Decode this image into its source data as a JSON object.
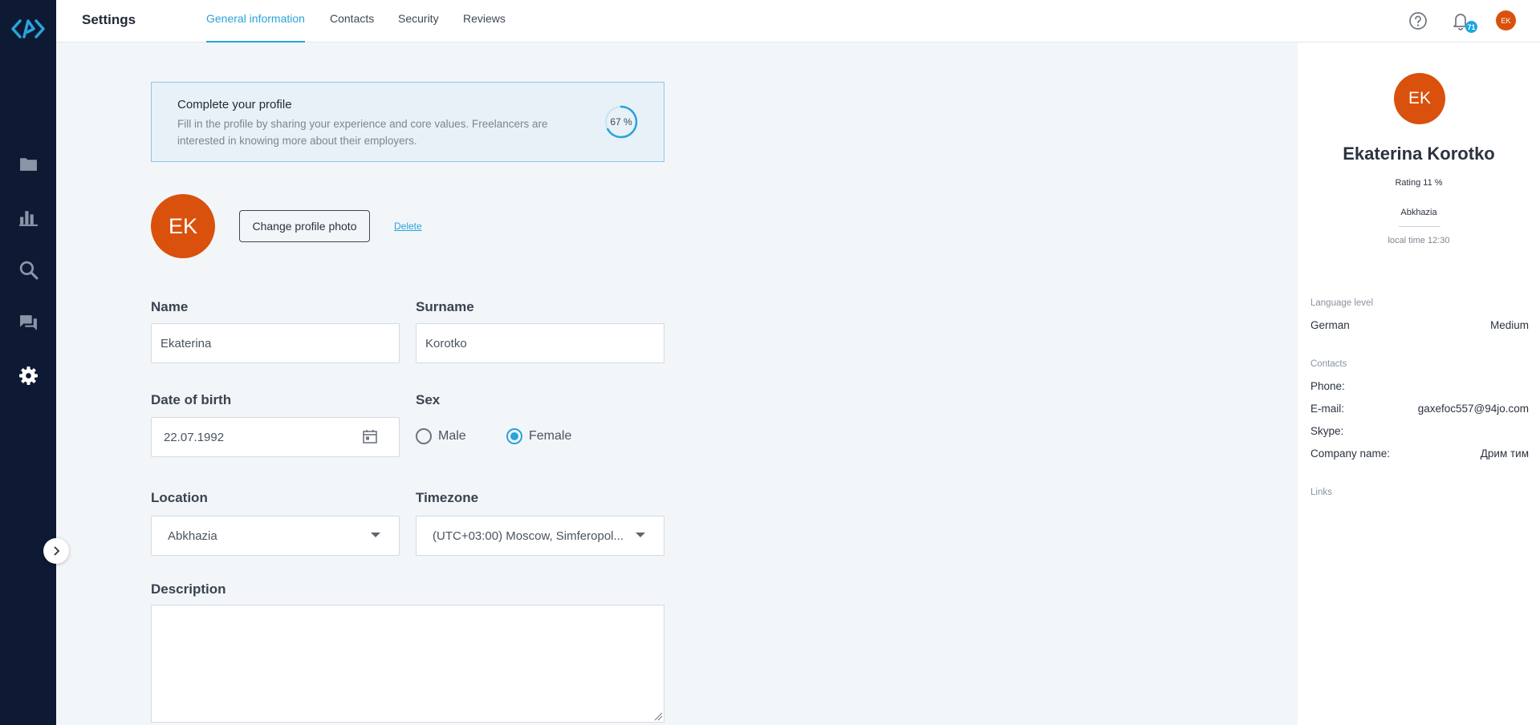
{
  "header": {
    "title": "Settings",
    "tabs": [
      {
        "label": "General information",
        "active": true
      },
      {
        "label": "Contacts",
        "active": false
      },
      {
        "label": "Security",
        "active": false
      },
      {
        "label": "Reviews",
        "active": false
      }
    ],
    "notifications_count": "71",
    "user_initials": "EK"
  },
  "sidebar": {
    "items": [
      {
        "icon": "folder-icon"
      },
      {
        "icon": "bar-chart-icon"
      },
      {
        "icon": "search-icon"
      },
      {
        "icon": "chat-icon"
      },
      {
        "icon": "gear-icon"
      }
    ]
  },
  "complete_profile": {
    "title": "Complete your profile",
    "text": "Fill in the profile by sharing your experience and core values. Freelancers are interested in knowing more about their employers.",
    "progress_percent": 67,
    "progress_label": "67 %"
  },
  "profile_photo": {
    "initials": "EK",
    "change_label": "Change profile photo",
    "delete_label": "Delete"
  },
  "form": {
    "name_label": "Name",
    "name_value": "Ekaterina",
    "surname_label": "Surname",
    "surname_value": "Korotko",
    "dob_label": "Date of birth",
    "dob_value": "22.07.1992",
    "sex_label": "Sex",
    "sex_options": [
      "Male",
      "Female"
    ],
    "sex_selected": "Female",
    "location_label": "Location",
    "location_value": "Abkhazia",
    "timezone_label": "Timezone",
    "timezone_value": "(UTC+03:00) Moscow, Simferopol...",
    "description_label": "Description",
    "description_value": ""
  },
  "summary": {
    "initials": "EK",
    "name": "Ekaterina Korotko",
    "rating": "Rating 11 %",
    "location": "Abkhazia",
    "local_time": "local time 12:30",
    "language_section": "Language level",
    "language": "German",
    "language_level": "Medium",
    "contacts_section": "Contacts",
    "phone_label": "Phone:",
    "email_label": "E-mail:",
    "email_value": "gaxefoc557@94jo.com",
    "skype_label": "Skype:",
    "company_label": "Company name:",
    "company_value": "Дрим тим",
    "links_section": "Links"
  },
  "colors": {
    "sidebar_bg": "#0e1a33",
    "accent": "#2aa3db",
    "avatar": "#d9510c"
  }
}
